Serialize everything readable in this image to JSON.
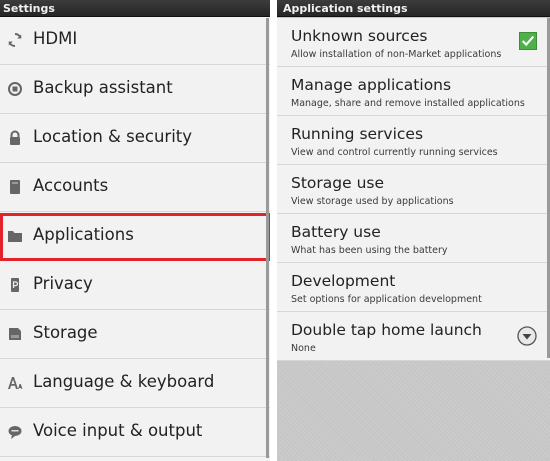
{
  "left": {
    "title": "Settings",
    "items": [
      {
        "label": "HDMI",
        "icon": "sync-icon"
      },
      {
        "label": "Backup assistant",
        "icon": "backup-icon"
      },
      {
        "label": "Location & security",
        "icon": "lock-icon"
      },
      {
        "label": "Accounts",
        "icon": "accounts-icon"
      },
      {
        "label": "Applications",
        "icon": "folder-icon",
        "selected": true
      },
      {
        "label": "Privacy",
        "icon": "privacy-icon"
      },
      {
        "label": "Storage",
        "icon": "storage-icon"
      },
      {
        "label": "Language & keyboard",
        "icon": "language-icon"
      },
      {
        "label": "Voice input & output",
        "icon": "speech-bubble-icon"
      }
    ],
    "highlight_color": "#e2232a"
  },
  "right": {
    "title": "Application settings",
    "items": [
      {
        "title": "Unknown sources",
        "summary": "Allow installation of non-Market applications",
        "control": "checkbox",
        "checked": true
      },
      {
        "title": "Manage applications",
        "summary": "Manage, share and remove installed applications"
      },
      {
        "title": "Running services",
        "summary": "View and control currently running services"
      },
      {
        "title": "Storage use",
        "summary": "View storage used by applications"
      },
      {
        "title": "Battery use",
        "summary": "What has been using the battery"
      },
      {
        "title": "Development",
        "summary": "Set options for application development"
      },
      {
        "title": "Double tap home launch",
        "summary": "None",
        "control": "dropdown"
      }
    ],
    "accent": "#4db04a"
  }
}
